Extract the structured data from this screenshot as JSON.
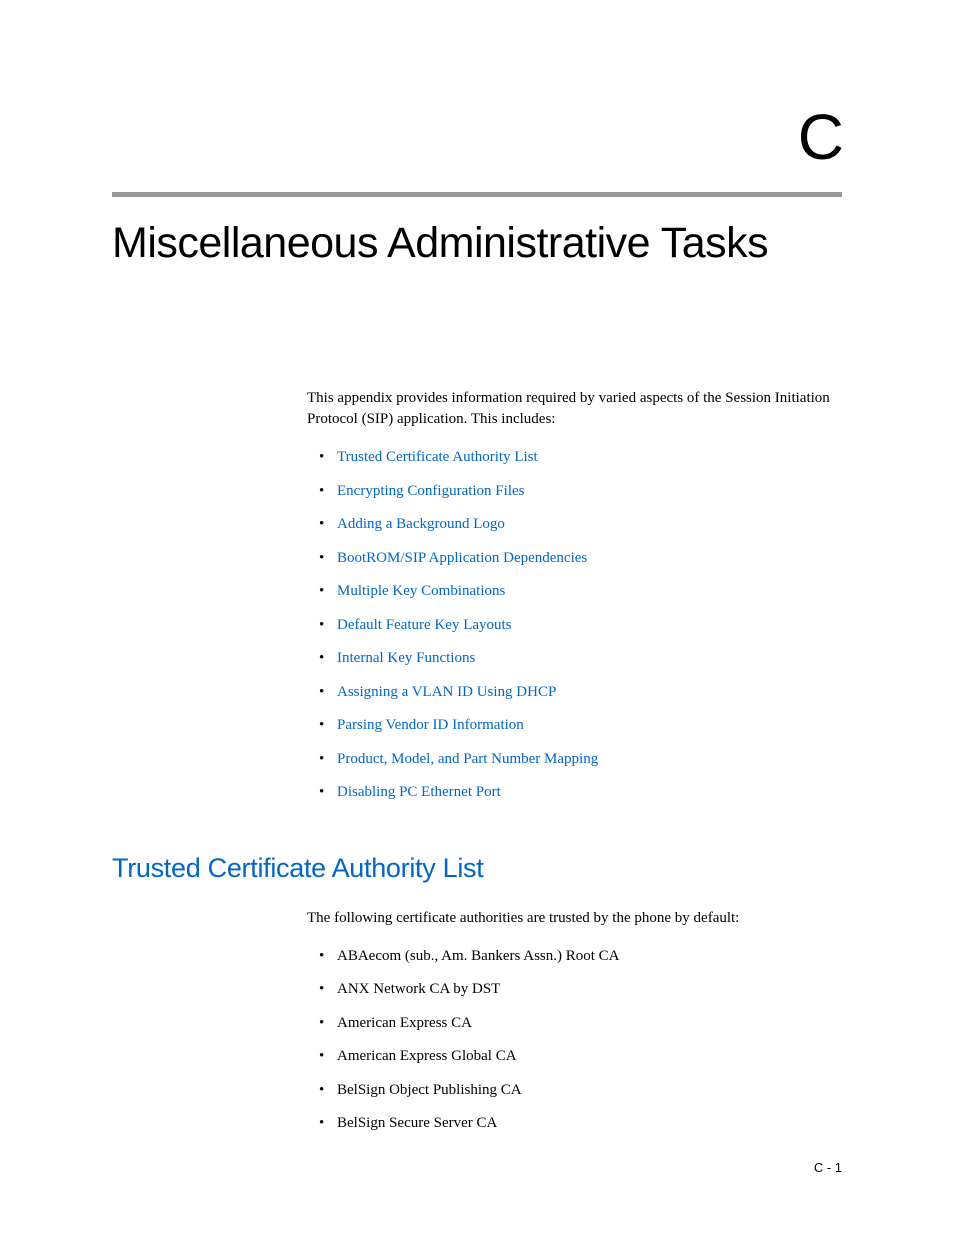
{
  "chapter_letter": "C",
  "chapter_title": "Miscellaneous Administrative Tasks",
  "intro": "This appendix provides information required by varied aspects of the Session Initiation Protocol (SIP) application. This includes:",
  "toc": [
    "Trusted Certificate Authority List",
    "Encrypting Configuration Files",
    "Adding a Background Logo",
    "BootROM/SIP Application Dependencies",
    "Multiple Key Combinations",
    "Default Feature Key Layouts",
    "Internal Key Functions",
    "Assigning a VLAN ID Using DHCP",
    "Parsing Vendor ID Information",
    "Product, Model, and Part Number Mapping",
    "Disabling PC Ethernet Port"
  ],
  "section": {
    "heading": "Trusted Certificate Authority List",
    "intro": "The following certificate authorities are trusted by the phone by default:",
    "items": [
      "ABAecom (sub., Am. Bankers Assn.) Root CA",
      "ANX Network CA by DST",
      "American Express CA",
      "American Express Global CA",
      "BelSign Object Publishing CA",
      "BelSign Secure Server CA"
    ]
  },
  "page_number": "C - 1"
}
